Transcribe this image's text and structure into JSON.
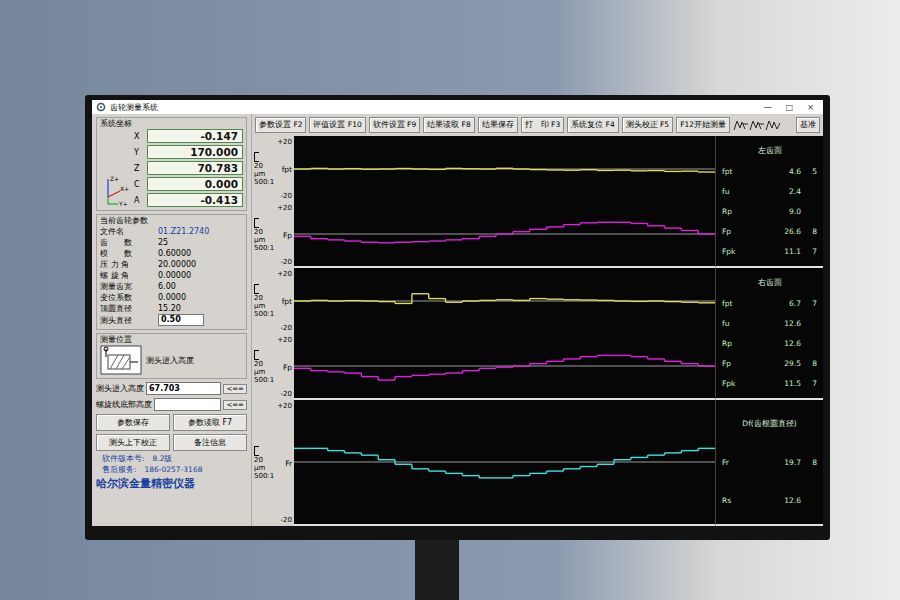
{
  "window": {
    "title": "齿轮测量系统",
    "controls": [
      "—",
      "□",
      "×"
    ]
  },
  "coordinates": {
    "title": "系统坐标",
    "axis_labels": [
      "Z+",
      "X+",
      "Y+"
    ],
    "axes": [
      {
        "name": "X",
        "value": "-0.147"
      },
      {
        "name": "Y",
        "value": "170.000"
      },
      {
        "name": "Z",
        "value": "70.783"
      },
      {
        "name": "C",
        "value": "0.000"
      },
      {
        "name": "A",
        "value": "-0.413"
      }
    ]
  },
  "gear_params": {
    "title": "当前齿轮参数",
    "rows": [
      {
        "label": "文件名",
        "value": "01.Z21.2740",
        "kind": "file"
      },
      {
        "label": "齿　　数",
        "value": "25",
        "kind": "text"
      },
      {
        "label": "模　　数",
        "value": "0.60000",
        "kind": "text"
      },
      {
        "label": "压 力 角",
        "value": "20.00000",
        "kind": "text"
      },
      {
        "label": "螺 旋 角",
        "value": "0.00000",
        "kind": "text"
      },
      {
        "label": "测量齿宽",
        "value": "6.00",
        "kind": "text"
      },
      {
        "label": "变位系数",
        "value": "0.0000",
        "kind": "text"
      },
      {
        "label": "顶圆直径",
        "value": "15.20",
        "kind": "text"
      },
      {
        "label": "测头直径",
        "value": "0.50",
        "kind": "field"
      }
    ]
  },
  "measure_position": {
    "title": "测量位置",
    "diagram_label": "测头进入高度"
  },
  "height_fields": [
    {
      "label": "测头进入高度",
      "value": "67.703",
      "button": "<=="
    },
    {
      "label": "螺旋线底部高度",
      "value": "",
      "button": "<=="
    }
  ],
  "left_buttons": [
    "参数保存",
    "参数读取 F7",
    "测头上下校正",
    "备注信息"
  ],
  "footer": [
    {
      "label": "软件版本号:",
      "value": "8.2版"
    },
    {
      "label": "售后服务:",
      "value": "186-0257-3168"
    }
  ],
  "brand": "哈尔滨金量精密仪器",
  "toolbar": [
    "参数设置 F2",
    "评值设置 F10",
    "软件设置 F9",
    "结果读取 F8",
    "结果保存",
    "打　印 F3",
    "系统复位 F4",
    "测头校正 F5",
    "F12开始测量"
  ],
  "reference_button": "基准",
  "sections": [
    {
      "title": "左齿面",
      "charts": [
        {
          "name": "fpt",
          "top": "+20",
          "bottom": "-20",
          "unit": "20",
          "unit_sub": "μm",
          "ratio": "500:1",
          "color": "#dede5a",
          "values": [
            0,
            0.5,
            0,
            0.3,
            -0.2,
            0,
            0.4,
            0,
            -0.3,
            0.5,
            0.2,
            0,
            0.6,
            0,
            -0.5,
            -0.8,
            -1,
            -0.6,
            -1.2,
            -1,
            -1.5,
            -1.3,
            -2,
            -1.8,
            -2.5
          ]
        },
        {
          "name": "Fp",
          "top": "+20",
          "bottom": "-20",
          "unit": "20",
          "unit_sub": "μm",
          "ratio": "500:1",
          "color": "#e020e0",
          "values": [
            -2,
            -4,
            -5,
            -6,
            -7,
            -7.5,
            -7,
            -6.5,
            -6,
            -5,
            -4,
            -2,
            0,
            2,
            4,
            6,
            8,
            9.5,
            10,
            10,
            9,
            7,
            5,
            3,
            0
          ]
        }
      ],
      "stats": [
        {
          "label": "fpt",
          "value": "4.6",
          "grade": "5"
        },
        {
          "label": "fu",
          "value": "2.4",
          "grade": ""
        },
        {
          "label": "Rp",
          "value": "9.0",
          "grade": ""
        },
        {
          "label": "Fp",
          "value": "26.6",
          "grade": "8"
        },
        {
          "label": "Fpk",
          "value": "11.1",
          "grade": "7"
        }
      ]
    },
    {
      "title": "右齿面",
      "charts": [
        {
          "name": "fpt",
          "top": "+20",
          "bottom": "-20",
          "unit": "20",
          "unit_sub": "μm",
          "ratio": "500:1",
          "color": "#dede5a",
          "values": [
            0,
            0.5,
            0,
            0.3,
            0,
            -0.5,
            -2,
            6,
            2,
            -1,
            0,
            0.5,
            1,
            0.5,
            2,
            1.5,
            1,
            0.8,
            0.5,
            0,
            -0.3,
            0,
            -0.5,
            -1,
            -1.5
          ]
        },
        {
          "name": "Fp",
          "top": "+20",
          "bottom": "-20",
          "unit": "20",
          "unit_sub": "μm",
          "ratio": "500:1",
          "color": "#e020e0",
          "values": [
            -2,
            -4,
            -5,
            -6,
            -9,
            -12,
            -9,
            -8,
            -7,
            -6,
            -4,
            -2,
            -1,
            0,
            2,
            4,
            6,
            8,
            9,
            9,
            8,
            6,
            4,
            2,
            0
          ]
        }
      ],
      "stats": [
        {
          "label": "fpt",
          "value": "6.7",
          "grade": "7"
        },
        {
          "label": "fu",
          "value": "12.6",
          "grade": ""
        },
        {
          "label": "Rp",
          "value": "12.6",
          "grade": ""
        },
        {
          "label": "Fp",
          "value": "29.5",
          "grade": "8"
        },
        {
          "label": "Fpk",
          "value": "11.5",
          "grade": "7"
        }
      ]
    },
    {
      "title": "Df(齿根圆直径)",
      "charts": [
        {
          "name": "Fr",
          "top": "+20",
          "bottom": "-20",
          "unit": "20",
          "unit_sub": "μm",
          "ratio": "500:1",
          "color": "#40e0e0",
          "values": [
            6,
            6,
            5,
            4,
            3,
            1,
            -1,
            -3,
            -4,
            -5,
            -6,
            -7,
            -7,
            -6,
            -5,
            -4,
            -3,
            -2,
            -1,
            1,
            2,
            3,
            4,
            5,
            6
          ]
        }
      ],
      "stats": [
        {
          "label": "Fr",
          "value": "19.7",
          "grade": "8"
        },
        {
          "label": "Rs",
          "value": "12.6",
          "grade": ""
        }
      ]
    }
  ]
}
